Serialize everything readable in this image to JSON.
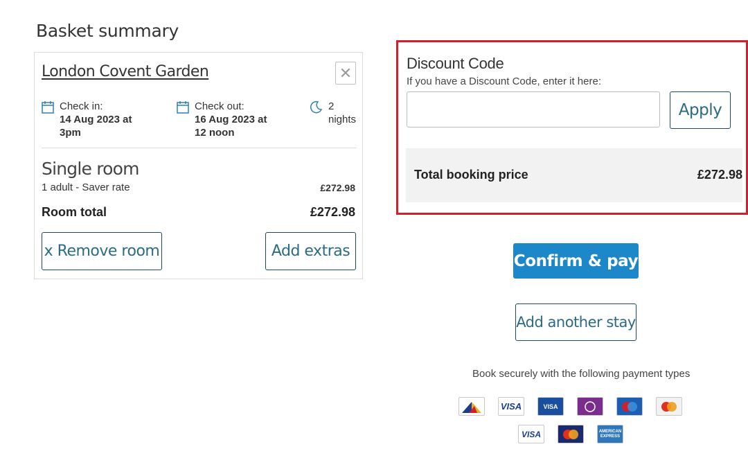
{
  "basket": {
    "title": "Basket summary",
    "hotel": "London Covent Garden",
    "checkin": {
      "label": "Check in:",
      "value": "14 Aug 2023 at\n3pm"
    },
    "checkout": {
      "label": "Check out:",
      "value": "16 Aug 2023 at\n12 noon"
    },
    "nights": {
      "count": "2",
      "label": "nights"
    },
    "room": {
      "name": "Single room",
      "details": "1 adult - Saver rate",
      "price": "£272.98",
      "total_label": "Room total",
      "total_value": "£272.98"
    },
    "remove_label": "x Remove room",
    "extras_label": "Add extras"
  },
  "discount": {
    "title": "Discount Code",
    "subtitle": "If you have a Discount Code, enter it here:",
    "input_value": "",
    "apply_label": "Apply",
    "total_label": "Total booking price",
    "total_value": "£272.98"
  },
  "actions": {
    "confirm_label": "Confirm & pay",
    "another_label": "Add another stay"
  },
  "payments": {
    "text": "Book securely with the following payment types",
    "row1": [
      "DELTA",
      "VISA",
      "VISA",
      "SOLO",
      "Maestro",
      "MasterCard"
    ],
    "row2": [
      "VISA",
      "MasterCard",
      "AMERICAN EXPRESS"
    ]
  },
  "colors": {
    "highlight_border": "#d0202b",
    "primary_button": "#1c87c9",
    "outline_button_border": "#1c4a5c",
    "outline_button_text": "#2a6b86",
    "icon_accent": "#2a7fb8"
  }
}
